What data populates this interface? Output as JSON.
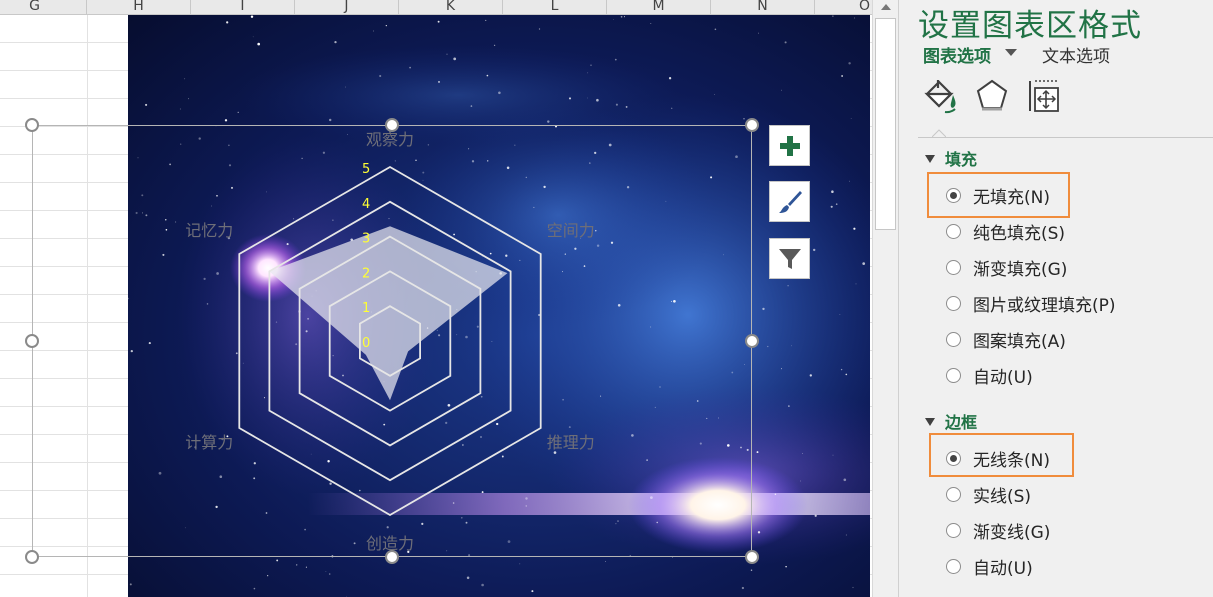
{
  "sheet": {
    "columns": [
      "G",
      "H",
      "I",
      "J",
      "K",
      "L",
      "M",
      "N",
      "O"
    ]
  },
  "chart_data": {
    "type": "radar",
    "categories": [
      "观察力",
      "空间力",
      "推理力",
      "创造力",
      "计算力",
      "记忆力"
    ],
    "series": [
      {
        "values": [
          3.3,
          3.9,
          0.6,
          1.7,
          0.8,
          4.0
        ]
      }
    ],
    "rlim": [
      0,
      5
    ],
    "tick_labels": [
      "0",
      "1",
      "2",
      "3",
      "4",
      "5"
    ],
    "grid": true,
    "colors": {
      "fill": "#e8e8f0",
      "grid": "#e6e6e6",
      "ticks": "#ffff33",
      "axis_labels": "#6e6e78"
    }
  },
  "chart_side_buttons": [
    {
      "name": "chart-elements-button",
      "icon": "plus-icon",
      "color": "#217346"
    },
    {
      "name": "chart-styles-button",
      "icon": "brush-icon",
      "color": "#2f5597"
    },
    {
      "name": "chart-filters-button",
      "icon": "filter-icon",
      "color": "#595959"
    }
  ],
  "pane": {
    "title": "设置图表区格式",
    "tab_chart_options": "图表选项",
    "tab_text_options": "文本选项",
    "icons": [
      "fill-line-icon",
      "effects-icon",
      "size-properties-icon"
    ],
    "fill": {
      "header": "填充",
      "options": [
        "无填充(N)",
        "纯色填充(S)",
        "渐变填充(G)",
        "图片或纹理填充(P)",
        "图案填充(A)",
        "自动(U)"
      ],
      "selected": "无填充(N)"
    },
    "border": {
      "header": "边框",
      "options": [
        "无线条(N)",
        "实线(S)",
        "渐变线(G)",
        "自动(U)"
      ],
      "selected": "无线条(N)"
    },
    "accent_color": "#217346",
    "highlight_color": "#f08c3c"
  }
}
